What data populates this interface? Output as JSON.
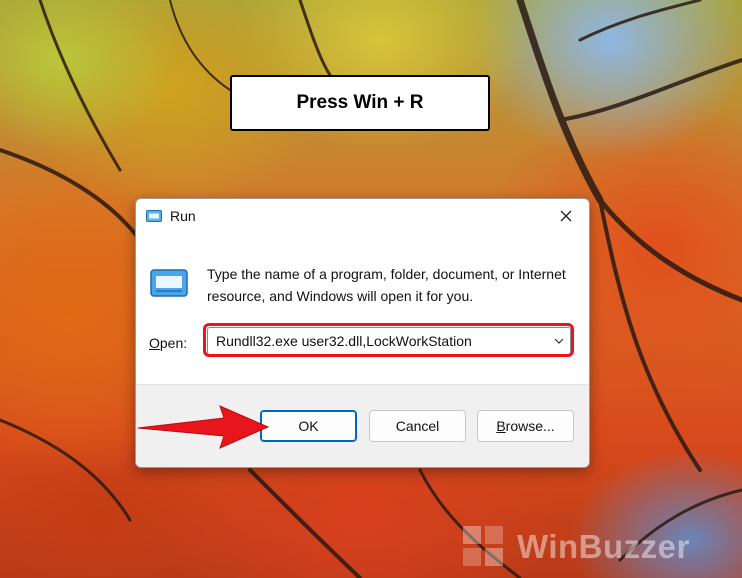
{
  "caption": {
    "text": "Press Win + R"
  },
  "dialog": {
    "title": "Run",
    "description": "Type the name of a program, folder, document, or Internet resource, and Windows will open it for you.",
    "open_label_underlined": "O",
    "open_label_rest": "pen:",
    "command_value": "Rundll32.exe user32.dll,LockWorkStation",
    "buttons": {
      "ok": "OK",
      "cancel": "Cancel",
      "browse_underlined": "B",
      "browse_rest": "rowse..."
    }
  },
  "watermark": {
    "text": "WinBuzzer"
  },
  "colors": {
    "highlight": "#e8161c",
    "arrow": "#e8161c",
    "ok_border": "#0067c0",
    "footer_bg": "#f0f0f0"
  },
  "icons": [
    "run-title-icon",
    "close-icon",
    "run-app-icon",
    "chevron-down-icon",
    "pointer-arrow-icon",
    "winbuzzer-logo-icon"
  ]
}
